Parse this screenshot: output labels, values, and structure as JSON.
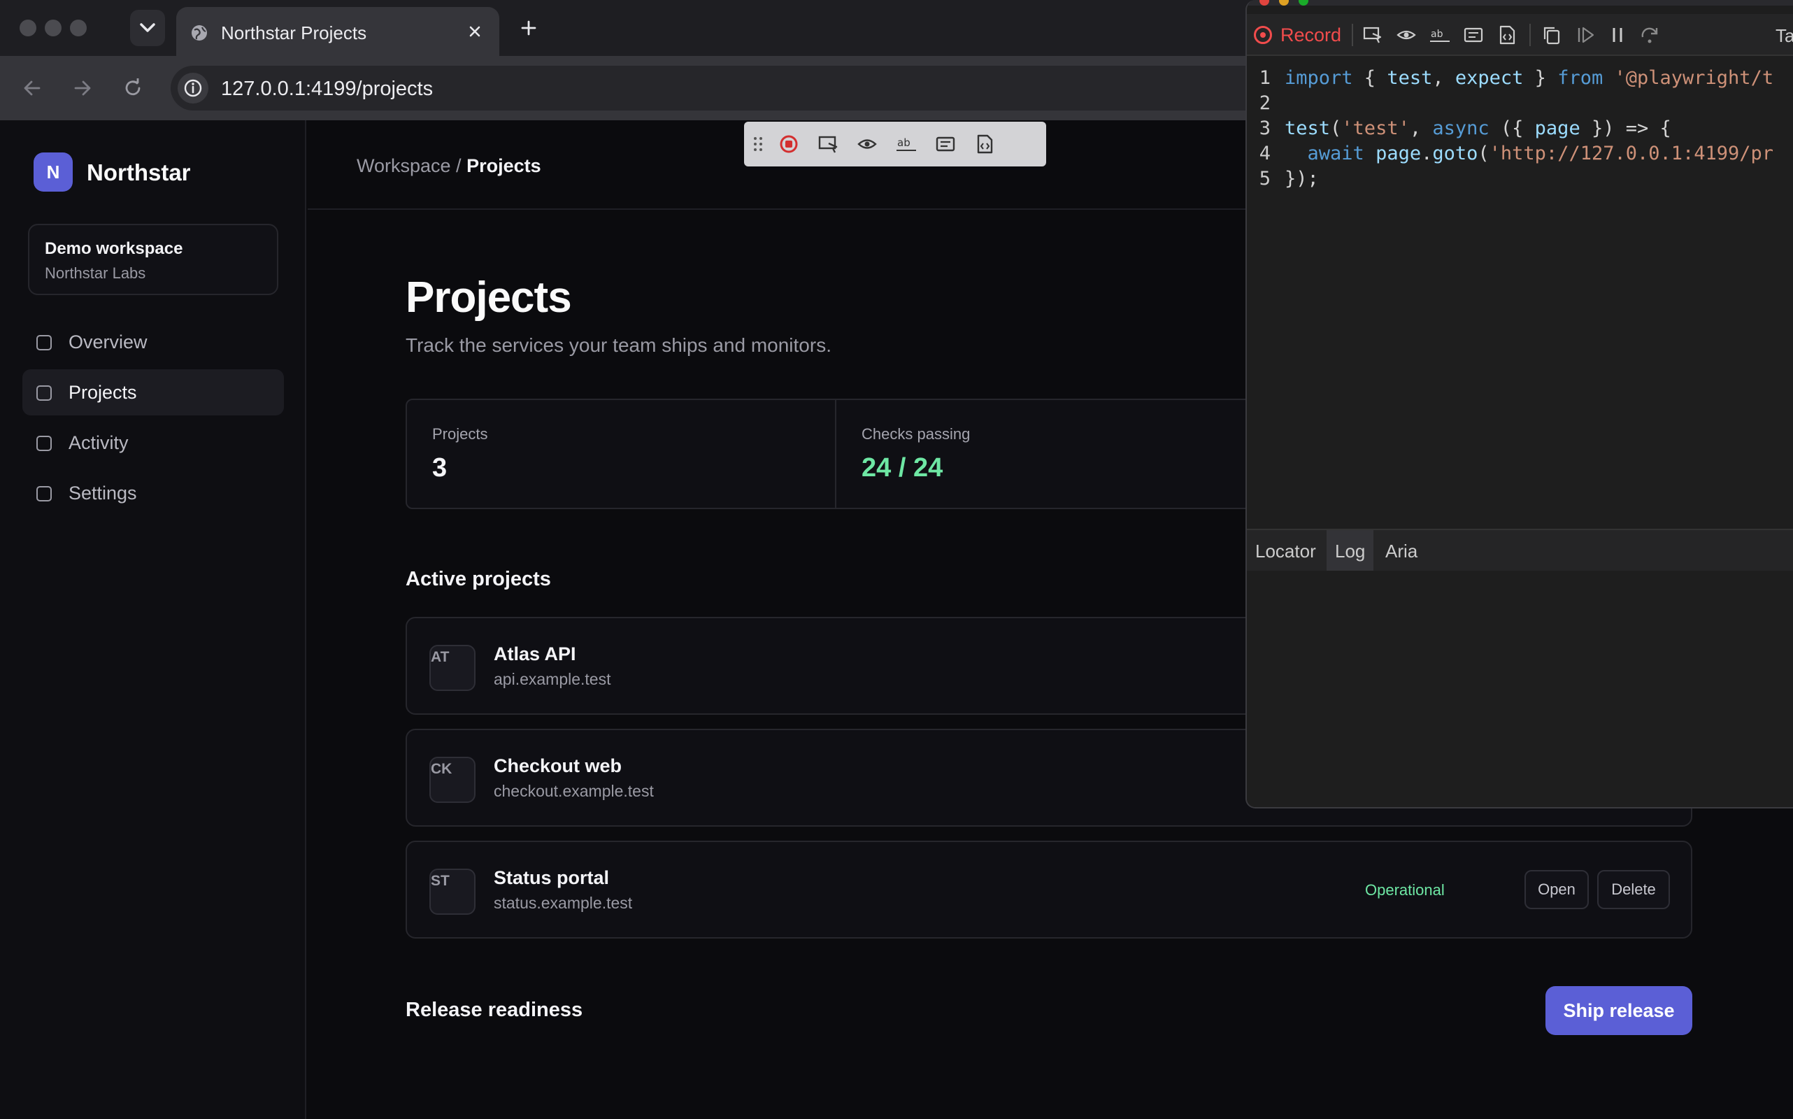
{
  "browser": {
    "tab_title": "Northstar Projects",
    "url": "127.0.0.1:4199/projects",
    "icons": [
      "tab-search-icon",
      "globe-icon",
      "close-icon",
      "plus-icon",
      "back-icon",
      "forward-icon",
      "reload-icon",
      "info-icon"
    ]
  },
  "app": {
    "brand_initial": "N",
    "brand_name": "Northstar",
    "workspace": {
      "name": "Demo workspace",
      "org": "Northstar Labs"
    },
    "nav": [
      {
        "label": "Overview",
        "active": false
      },
      {
        "label": "Projects",
        "active": true
      },
      {
        "label": "Activity",
        "active": false
      },
      {
        "label": "Settings",
        "active": false
      }
    ],
    "breadcrumb": {
      "parent": "Workspace /",
      "current": "Projects"
    },
    "page_title": "Projects",
    "page_subtitle": "Track the services your team ships and monitors.",
    "stats": [
      {
        "label": "Projects",
        "value": "3"
      },
      {
        "label": "Checks passing",
        "value": "24 / 24"
      }
    ],
    "section_active": "Active projects",
    "projects": [
      {
        "initials": "AT",
        "name": "Atlas API",
        "domain": "api.example.test",
        "status": "",
        "open": "",
        "delete": ""
      },
      {
        "initials": "CK",
        "name": "Checkout web",
        "domain": "checkout.example.test",
        "status": "",
        "open": "",
        "delete": ""
      },
      {
        "initials": "ST",
        "name": "Status portal",
        "domain": "status.example.test",
        "status": "Operational",
        "open": "Open",
        "delete": "Delete"
      }
    ],
    "section_release": "Release readiness",
    "ship_button": "Ship release",
    "colors": {
      "accent": "#5b5fd6",
      "success": "#6ee7a4"
    }
  },
  "inspector": {
    "record_label": "Record",
    "cutoff_label": "Ta",
    "code": {
      "l1": {
        "n": "1",
        "a": "import",
        "b": " { ",
        "c": "test",
        "d": ", ",
        "e": "expect",
        "f": " } ",
        "g": "from",
        "h": " ",
        "i": "'@playwright/t"
      },
      "l2": {
        "n": "2"
      },
      "l3": {
        "n": "3",
        "a": "test",
        "b": "(",
        "c": "'test'",
        "d": ", ",
        "e": "async",
        "f": " ({ ",
        "g": "page",
        "h": " }) => {"
      },
      "l4": {
        "n": "4",
        "a": "  await",
        "b": " ",
        "c": "page",
        "d": ".",
        "e": "goto",
        "f": "(",
        "g": "'http://127.0.0.1:4199/pr"
      },
      "l5": {
        "n": "5",
        "a": "});"
      }
    },
    "tabs": [
      "Locator",
      "Log",
      "Aria"
    ]
  }
}
